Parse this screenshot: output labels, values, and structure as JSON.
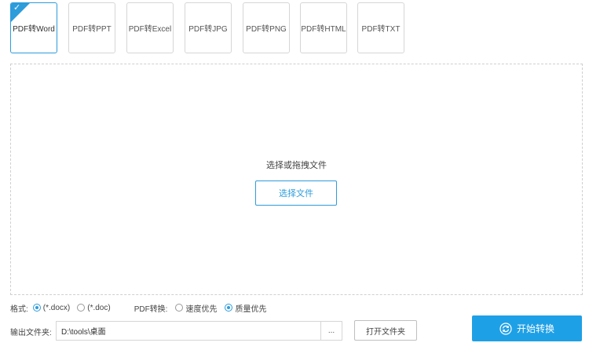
{
  "tabs": [
    {
      "label": "PDF转Word",
      "active": true
    },
    {
      "label": "PDF转PPT",
      "active": false
    },
    {
      "label": "PDF转Excel",
      "active": false
    },
    {
      "label": "PDF转JPG",
      "active": false
    },
    {
      "label": "PDF转PNG",
      "active": false
    },
    {
      "label": "PDF转HTML",
      "active": false
    },
    {
      "label": "PDF转TXT",
      "active": false
    }
  ],
  "dropzone": {
    "hint": "选择或拖拽文件",
    "select_button": "选择文件"
  },
  "options": {
    "format_label": "格式:",
    "format_options": [
      "(*.docx)",
      "(*.doc)"
    ],
    "format_selected": "(*.docx)",
    "mode_label": "PDF转换:",
    "mode_options": [
      "速度优先",
      "质量优先"
    ],
    "mode_selected": "质量优先"
  },
  "output": {
    "label": "输出文件夹:",
    "path": "D:\\tools\\桌面",
    "browse_label": "...",
    "open_folder_label": "打开文件夹"
  },
  "convert_button": "开始转换",
  "colors": {
    "accent": "#2d9cdb",
    "primary_button": "#1ea0e6"
  }
}
